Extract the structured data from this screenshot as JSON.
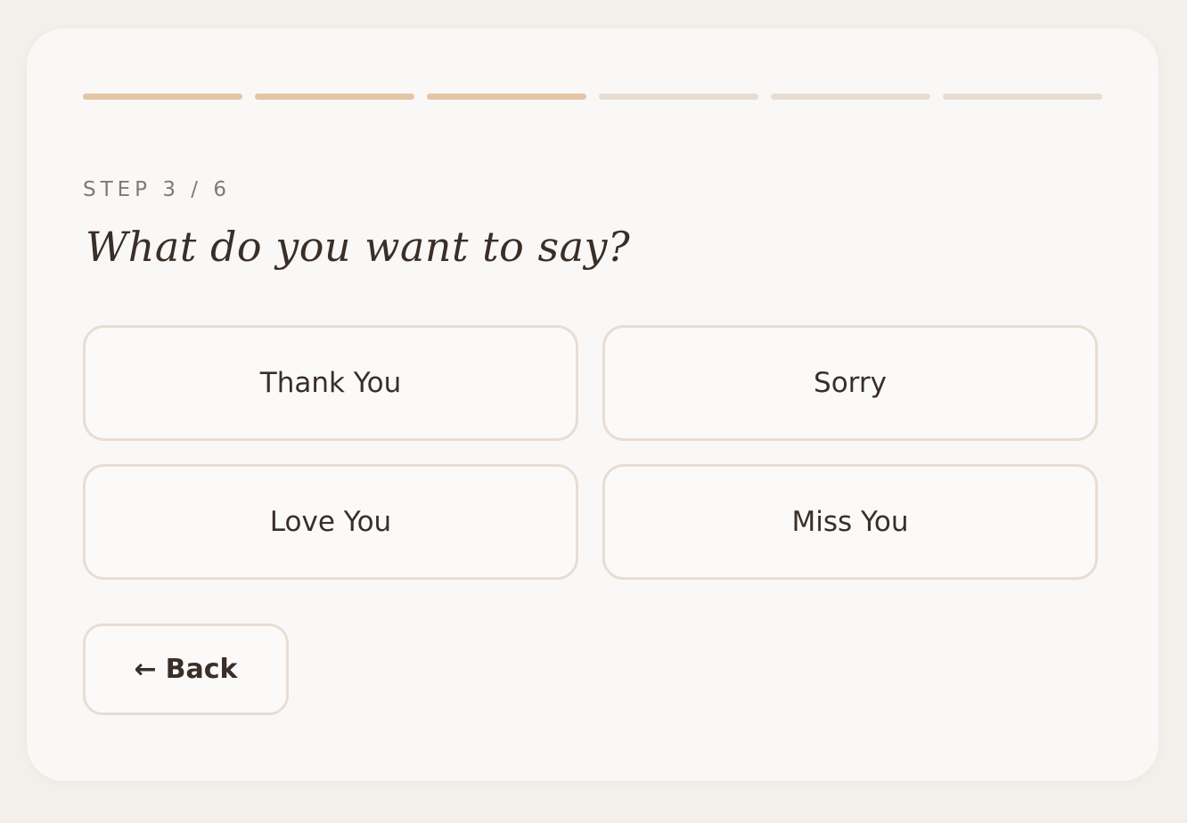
{
  "progress": {
    "total_steps": 6,
    "completed_steps": 3,
    "completed_color": "#e3c5a6",
    "remaining_color": "#e7ddd3"
  },
  "step_label": "STEP 3 / 6",
  "question": "What do you want to say?",
  "options": [
    {
      "label": "Thank You"
    },
    {
      "label": "Sorry"
    },
    {
      "label": "Love You"
    },
    {
      "label": "Miss You"
    }
  ],
  "back": {
    "icon": "arrow-left-icon",
    "arrow_glyph": "←",
    "label": "Back"
  }
}
